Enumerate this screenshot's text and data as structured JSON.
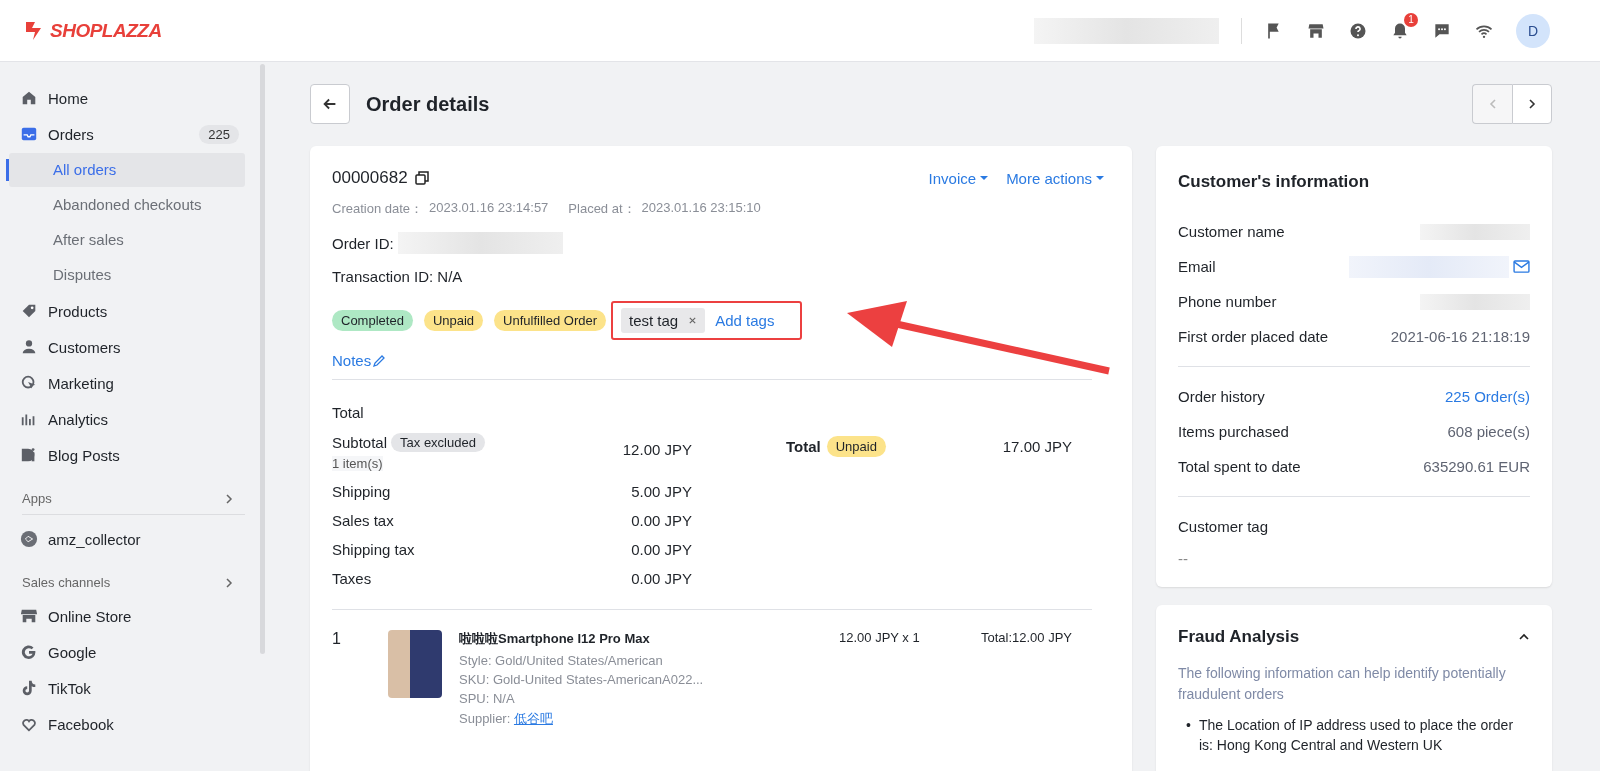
{
  "topbar": {
    "brand": "SHOPLAZZA",
    "notification_count": "1",
    "avatar": "D"
  },
  "sidebar": {
    "sections": [
      {
        "items": [
          {
            "label": "Home",
            "selected": false
          },
          {
            "label": "Orders",
            "selected": false,
            "badge": "225",
            "children": [
              {
                "label": "All orders",
                "selected": true
              },
              {
                "label": "Abandoned checkouts",
                "selected": false
              },
              {
                "label": "After sales",
                "selected": false
              },
              {
                "label": "Disputes",
                "selected": false
              }
            ]
          },
          {
            "label": "Products",
            "selected": false
          },
          {
            "label": "Customers",
            "selected": false
          },
          {
            "label": "Marketing",
            "selected": false
          },
          {
            "label": "Analytics",
            "selected": false
          },
          {
            "label": "Blog Posts",
            "selected": false
          }
        ]
      },
      {
        "title": "Apps",
        "items": [
          {
            "label": "amz_collector",
            "selected": false
          }
        ]
      },
      {
        "title": "Sales channels",
        "items": [
          {
            "label": "Online Store",
            "selected": false
          },
          {
            "label": "Google",
            "selected": false
          },
          {
            "label": "TikTok",
            "selected": false
          },
          {
            "label": "Facebook",
            "selected": false
          }
        ]
      }
    ]
  },
  "page": {
    "title": "Order details"
  },
  "order": {
    "number": "00000682",
    "actions": [
      "Invoice",
      "More actions"
    ],
    "dates": [
      {
        "label": "Creation date：",
        "value": "2023.01.16 23:14:57"
      },
      {
        "label": "Placed at：",
        "value": "2023.01.16 23:15:10"
      }
    ],
    "order_id_label": "Order ID:",
    "transaction": "Transaction ID: N/A",
    "statuses": [
      {
        "label": "Completed",
        "color": "#aee8c4"
      },
      {
        "label": "Unpaid",
        "color": "#fce38a"
      },
      {
        "label": "Unfulfilled Order",
        "color": "#fce38a"
      }
    ],
    "tags": [
      {
        "label": "test tag"
      }
    ],
    "add_tags": "Add tags",
    "notes": "Notes"
  },
  "totals": {
    "heading": "Total",
    "rows": [
      {
        "label": "Subtotal",
        "badge": "Tax excluded",
        "note": "1 item(s)",
        "value": "12.00 JPY"
      },
      {
        "label": "Shipping",
        "value": "5.00 JPY"
      },
      {
        "label": "Sales tax",
        "value": "0.00 JPY"
      },
      {
        "label": "Shipping tax",
        "value": "0.00 JPY"
      },
      {
        "label": "Taxes",
        "value": "0.00 JPY"
      }
    ],
    "summary": {
      "label": "Total",
      "badge": "Unpaid",
      "value": "17.00 JPY"
    }
  },
  "line_item": {
    "index": "1",
    "title": "啦啦啦Smartphone I12 Pro Max",
    "details": [
      "Style: Gold/United States/American",
      "SKU: Gold-United States-AmericanA022...",
      "SPU: N/A"
    ],
    "supplier_label": "Supplier:",
    "supplier": "低谷吧",
    "price": "12.00 JPY x 1",
    "total": "Total:12.00 JPY"
  },
  "customer": {
    "title": "Customer's information",
    "groups": [
      [
        {
          "label": "Customer name",
          "kind": "hidden"
        },
        {
          "label": "Email",
          "kind": "email"
        },
        {
          "label": "Phone number",
          "kind": "hidden"
        },
        {
          "label": "First order placed date",
          "kind": "text",
          "value": "2021-06-16 21:18:19"
        }
      ],
      [
        {
          "label": "Order history",
          "kind": "link",
          "value": "225 Order(s)"
        },
        {
          "label": "Items purchased",
          "kind": "text",
          "value": "608 piece(s)"
        },
        {
          "label": "Total spent to date",
          "kind": "text",
          "value": "635290.61 EUR"
        }
      ]
    ],
    "tag_label": "Customer tag",
    "tag_value": "--"
  },
  "fraud": {
    "title": "Fraud Analysis",
    "expanded": true,
    "description": "The following information can help identify potentially fraudulent orders",
    "bullet_marker": "•",
    "bullets": [
      "The Location of IP address used to place the order is: Hong Kong Central and Western UK"
    ]
  }
}
